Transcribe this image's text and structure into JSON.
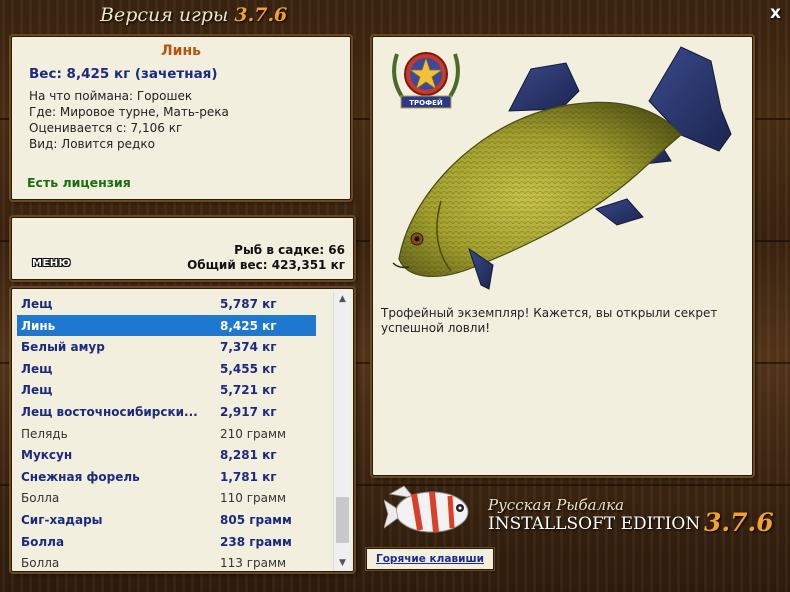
{
  "header": {
    "title_text": "Версия игры",
    "title_version": "3.7.6",
    "close_label": "x"
  },
  "catch_info": {
    "fish_name": "Линь",
    "weight_line": "Вес: 8,425 кг (зачетная)",
    "bait_line": "На что поймана: Горошек",
    "where_line": "Где: Мировое турне, Мать-река",
    "rated_line": "Оценивается с: 7,106 кг",
    "kind_line": "Вид: Ловится редко",
    "license": "Есть лицензия"
  },
  "summary": {
    "menu_label": "МЕНЮ",
    "fish_count": "Рыб в садке: 66",
    "total_weight": "Общий вес: 423,351 кг"
  },
  "fish_list": [
    {
      "name": "Лещ",
      "weight": "5,787 кг",
      "style": "bold"
    },
    {
      "name": "Линь",
      "weight": "8,425 кг",
      "style": "selected"
    },
    {
      "name": "Белый амур",
      "weight": "7,374 кг",
      "style": "bold"
    },
    {
      "name": "Лещ",
      "weight": "5,455 кг",
      "style": "bold"
    },
    {
      "name": "Лещ",
      "weight": "5,721 кг",
      "style": "bold"
    },
    {
      "name": "Лещ восточносибирски...",
      "weight": "2,917 кг",
      "style": "bold"
    },
    {
      "name": "Пелядь",
      "weight": "210 грамм",
      "style": "plain"
    },
    {
      "name": "Муксун",
      "weight": "8,281 кг",
      "style": "bold"
    },
    {
      "name": "Снежная форель",
      "weight": "1,781 кг",
      "style": "bold"
    },
    {
      "name": "Болла",
      "weight": "110 грамм",
      "style": "plain"
    },
    {
      "name": "Сиг-хадары",
      "weight": "805 грамм",
      "style": "bold"
    },
    {
      "name": "Болла",
      "weight": "238 грамм",
      "style": "bold"
    },
    {
      "name": "Болла",
      "weight": "113 грамм",
      "style": "plain"
    }
  ],
  "scrollbar": {
    "up_icon": "▲",
    "down_icon": "▼"
  },
  "trophy": {
    "badge_label": "ТРОФЕЙ",
    "description": "Трофейный экземпляр! Кажется, вы открыли секрет успешной ловли!"
  },
  "brand": {
    "name": "Русская Рыбалка",
    "edition": "INSTALLSOFT EDITION",
    "version": "3.7.6"
  },
  "hotkeys_label": "Горячие клавиши",
  "colors": {
    "accent_orange": "#f2a030",
    "fish_name": "#b8540c",
    "bold_blue": "#1a2a80",
    "selected_row": "#1e78d0",
    "license_green": "#1a6e12",
    "panel_bg": "#f3efdf"
  }
}
